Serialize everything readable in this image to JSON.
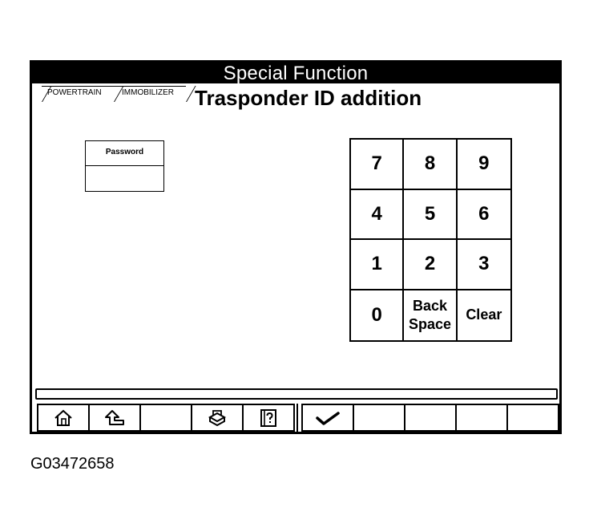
{
  "window": {
    "title": "Special Function"
  },
  "breadcrumb": {
    "tabs": [
      "POWERTRAIN",
      "IMMOBILIZER"
    ]
  },
  "page": {
    "title": "Trasponder ID addition"
  },
  "password": {
    "label": "Password",
    "value": ""
  },
  "keypad": {
    "keys": [
      {
        "id": "7",
        "label": "7"
      },
      {
        "id": "8",
        "label": "8"
      },
      {
        "id": "9",
        "label": "9"
      },
      {
        "id": "4",
        "label": "4"
      },
      {
        "id": "5",
        "label": "5"
      },
      {
        "id": "6",
        "label": "6"
      },
      {
        "id": "1",
        "label": "1"
      },
      {
        "id": "2",
        "label": "2"
      },
      {
        "id": "3",
        "label": "3"
      },
      {
        "id": "0",
        "label": "0"
      },
      {
        "id": "backspace",
        "label": "Back\nSpace"
      },
      {
        "id": "clear",
        "label": "Clear"
      }
    ]
  },
  "toolbar": {
    "left_icons": [
      "home-icon",
      "back-arrow-icon",
      "",
      "print-icon",
      "help-book-icon"
    ],
    "right_icons": [
      "checkmark-icon",
      "",
      "",
      "",
      ""
    ]
  },
  "caption": {
    "text": "G03472658"
  }
}
